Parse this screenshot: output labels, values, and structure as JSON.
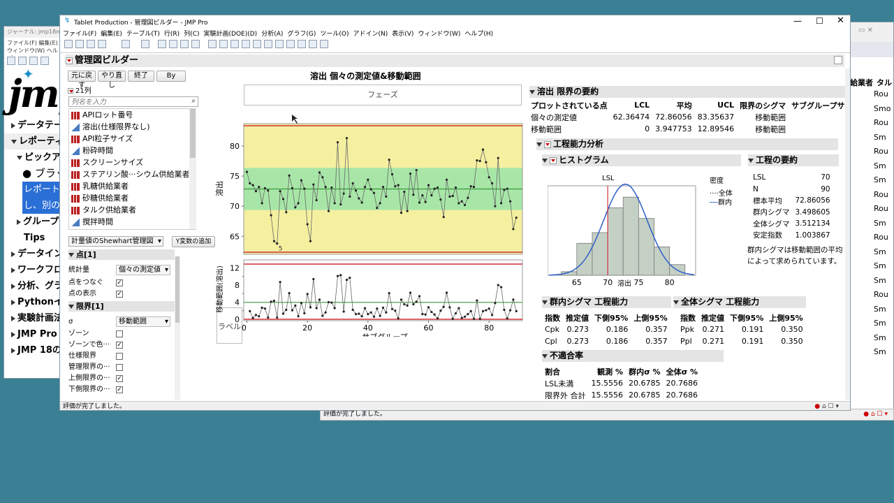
{
  "bg_window": {
    "title": "ジャーナル: jmp18m...",
    "menu": [
      "ファイル(F)",
      "編集(E)",
      "ウィンドウ(W)",
      "ヘルプ(H)"
    ],
    "logo": "jmp",
    "items": [
      "データテーブ",
      "レポーティン",
      "ピックアッ",
      "● ブラッ",
      "レポート",
      "し、別の",
      "グループ",
      "Tips",
      "データイン",
      "ワークフロー",
      "分析、グラフ",
      "Pythonイン",
      "実験計画法",
      "JMP Pro 18",
      "JMP 18の"
    ]
  },
  "right_table": {
    "headers": [
      "給業者",
      "タル"
    ],
    "cells": [
      "Rou",
      "Smo",
      "Rou",
      "Sm",
      "Rou",
      "Sm",
      "Sm",
      "Rou",
      "Rou",
      "Sm",
      "Rou",
      "Sm",
      "Sm",
      "Sm",
      "Rou",
      "Sm",
      "Sm",
      "Sm",
      "Sm"
    ]
  },
  "main": {
    "title": "Tablet Production - 管理図ビルダー - JMP Pro",
    "menu": [
      "ファイル(F)",
      "編集(E)",
      "テーブル(T)",
      "行(R)",
      "列(C)",
      "実験計画(DOE)(D)",
      "分析(A)",
      "グラフ(G)",
      "ツール(O)",
      "アドイン(N)",
      "表示(V)",
      "ウィンドウ(W)",
      "ヘルプ(H)"
    ],
    "status": "評価が完了しました。"
  },
  "builder": {
    "title": "管理図ビルダー",
    "buttons": {
      "undo": "元に戻す",
      "redo": "やり直し",
      "done": "終了",
      "by": "By"
    },
    "col_count": "21列",
    "search_placeholder": "列名を入力",
    "columns": [
      {
        "name": "APIロット番号",
        "type": "red"
      },
      {
        "name": "溶出(仕様限界なし)",
        "type": "blue"
      },
      {
        "name": "API粒子サイズ",
        "type": "red"
      },
      {
        "name": "粉砕時間",
        "type": "blue"
      },
      {
        "name": "スクリーンサイズ",
        "type": "red"
      },
      {
        "name": "ステアリン酸···シウム供給業者",
        "type": "red"
      },
      {
        "name": "乳糖供給業者",
        "type": "red"
      },
      {
        "name": "砂糖供給業者",
        "type": "red"
      },
      {
        "name": "タルク供給業者",
        "type": "red"
      },
      {
        "name": "撹拌時間",
        "type": "blue"
      }
    ],
    "chart_type": "計量値のShewhart管理図",
    "add_y": "Y変数の追加",
    "points_section": "点[1]",
    "stat_label": "統計量",
    "stat_value": "個々の測定値",
    "connect_label": "点をつなぐ",
    "show_label": "点の表示",
    "limits_section": "限界[1]",
    "sigma_label": "σ",
    "sigma_value": "移動範囲",
    "limit_opts": [
      {
        "label": "ゾーン",
        "checked": false
      },
      {
        "label": "ゾーンで色···",
        "checked": true
      },
      {
        "label": "仕様限界",
        "checked": false
      },
      {
        "label": "管理限界の···",
        "checked": false
      },
      {
        "label": "上側限界の···",
        "checked": true
      },
      {
        "label": "下側限界の···",
        "checked": true
      }
    ]
  },
  "chart_data": {
    "type": "line",
    "title": "溶出 個々の測定値&移動範囲",
    "phase_label": "フェーズ",
    "label_btn": "ラベル",
    "xlabel": "サブグループ",
    "ylabel_top": "溶出",
    "ylabel_bottom": "移動範囲(溶出)",
    "x_ticks": [
      0,
      20,
      40,
      60,
      80
    ],
    "y_ticks_top": [
      65,
      70,
      75,
      80
    ],
    "y_ticks_bottom": [
      0,
      2,
      4,
      6,
      8,
      10,
      12
    ],
    "ylim_top": [
      62.36474,
      83.35637
    ],
    "ylim_bottom": [
      0,
      12.89546
    ],
    "lcl": 62.36474,
    "center": 72.86056,
    "ucl": 83.35637,
    "mr_center": 3.947753,
    "mr_ucl": 12.89546,
    "point_label": "5",
    "values": [
      75.7,
      73.8,
      73.5,
      72.5,
      73.2,
      70.5,
      73.0,
      72.6,
      68.5,
      64.2,
      63.8,
      72.5,
      71.2,
      69.0,
      75.1,
      73.0,
      69.8,
      70.5,
      74.3,
      72.9,
      67.0,
      64.2,
      73.6,
      71.0,
      75.6,
      74.8,
      73.2,
      69.2,
      73.1,
      70.5,
      80.6,
      70.3,
      72.1,
      81.3,
      71.6,
      73.8,
      72.6,
      71.3,
      70.6,
      73.2,
      74.4,
      72.8,
      72.2,
      69.7,
      70.5,
      73.2,
      71.6,
      77.7,
      75.3,
      73.3,
      73.5,
      68.9,
      72.4,
      69.2,
      75.4,
      71.9,
      76.0,
      70.6,
      71.8,
      70.7,
      73.5,
      71.8,
      72.9,
      73.1,
      71.1,
      68.2,
      74.4,
      71.6,
      71.7,
      73.1,
      70.5,
      70.8,
      70.2,
      71.4,
      73.3,
      73.2,
      77.6,
      77.5,
      79.4,
      77.3,
      74.8,
      73.8,
      70.0,
      78.0,
      70.5,
      72.7,
      72.9,
      70.8,
      66.2,
      68.1
    ]
  },
  "capability": {
    "limits_title": "溶出 限界の要約",
    "limits_headers": [
      "プロットされている点",
      "LCL",
      "平均",
      "UCL",
      "限界のシグマ",
      "サブグループサイズ"
    ],
    "limits_rows": [
      [
        "個々の測定値",
        "62.36474",
        "72.86056",
        "83.35637",
        "移動範囲",
        "1"
      ],
      [
        "移動範囲",
        "0",
        "3.947753",
        "12.89546",
        "移動範囲",
        "1"
      ]
    ],
    "analysis_title": "工程能力分析",
    "histogram_title": "ヒストグラム",
    "hist_lsl_label": "LSL",
    "hist_xlabel": "溶出",
    "hist_x_ticks": [
      "65",
      "70",
      "75",
      "80"
    ],
    "hist_counts": [
      1,
      9,
      12,
      19,
      22,
      16,
      8,
      3
    ],
    "hist_bin_edges": [
      62.5,
      65,
      67.5,
      70,
      72.5,
      75,
      77.5,
      80,
      82.5
    ],
    "density_label": "密度",
    "legend_overall": "全体",
    "legend_within": "群内",
    "summary_title": "工程の要約",
    "summary_rows": [
      [
        "LSL",
        "70"
      ],
      [
        "N",
        "90"
      ],
      [
        "標本平均",
        "72.86056"
      ],
      [
        "群内シグマ",
        "3.498605"
      ],
      [
        "全体シグマ",
        "3.512134"
      ],
      [
        "安定指数",
        "1.003867"
      ]
    ],
    "note": "群内シグマは移動範囲の平均によって求められています。",
    "within_title": "群内シグマ 工程能力",
    "within_headers": [
      "指数",
      "推定値",
      "下側95%",
      "上側95%"
    ],
    "within_rows": [
      [
        "Cpk",
        "0.273",
        "0.186",
        "0.357"
      ],
      [
        "Cpl",
        "0.273",
        "0.186",
        "0.357"
      ]
    ],
    "overall_title": "全体シグマ 工程能力",
    "overall_headers": [
      "指数",
      "推定値",
      "下側95%",
      "上側95%"
    ],
    "overall_rows": [
      [
        "Ppk",
        "0.271",
        "0.191",
        "0.350"
      ],
      [
        "Ppl",
        "0.271",
        "0.191",
        "0.350"
      ]
    ],
    "nonconf_title": "不適合率",
    "nonconf_headers": [
      "割合",
      "観測 %",
      "群内σ %",
      "全体σ %"
    ],
    "nonconf_rows": [
      [
        "LSL未満",
        "15.5556",
        "20.6785",
        "20.7686"
      ],
      [
        "限界外 合計",
        "15.5556",
        "20.6785",
        "20.7686"
      ]
    ]
  },
  "bottom_status": "評価が完了しました。"
}
